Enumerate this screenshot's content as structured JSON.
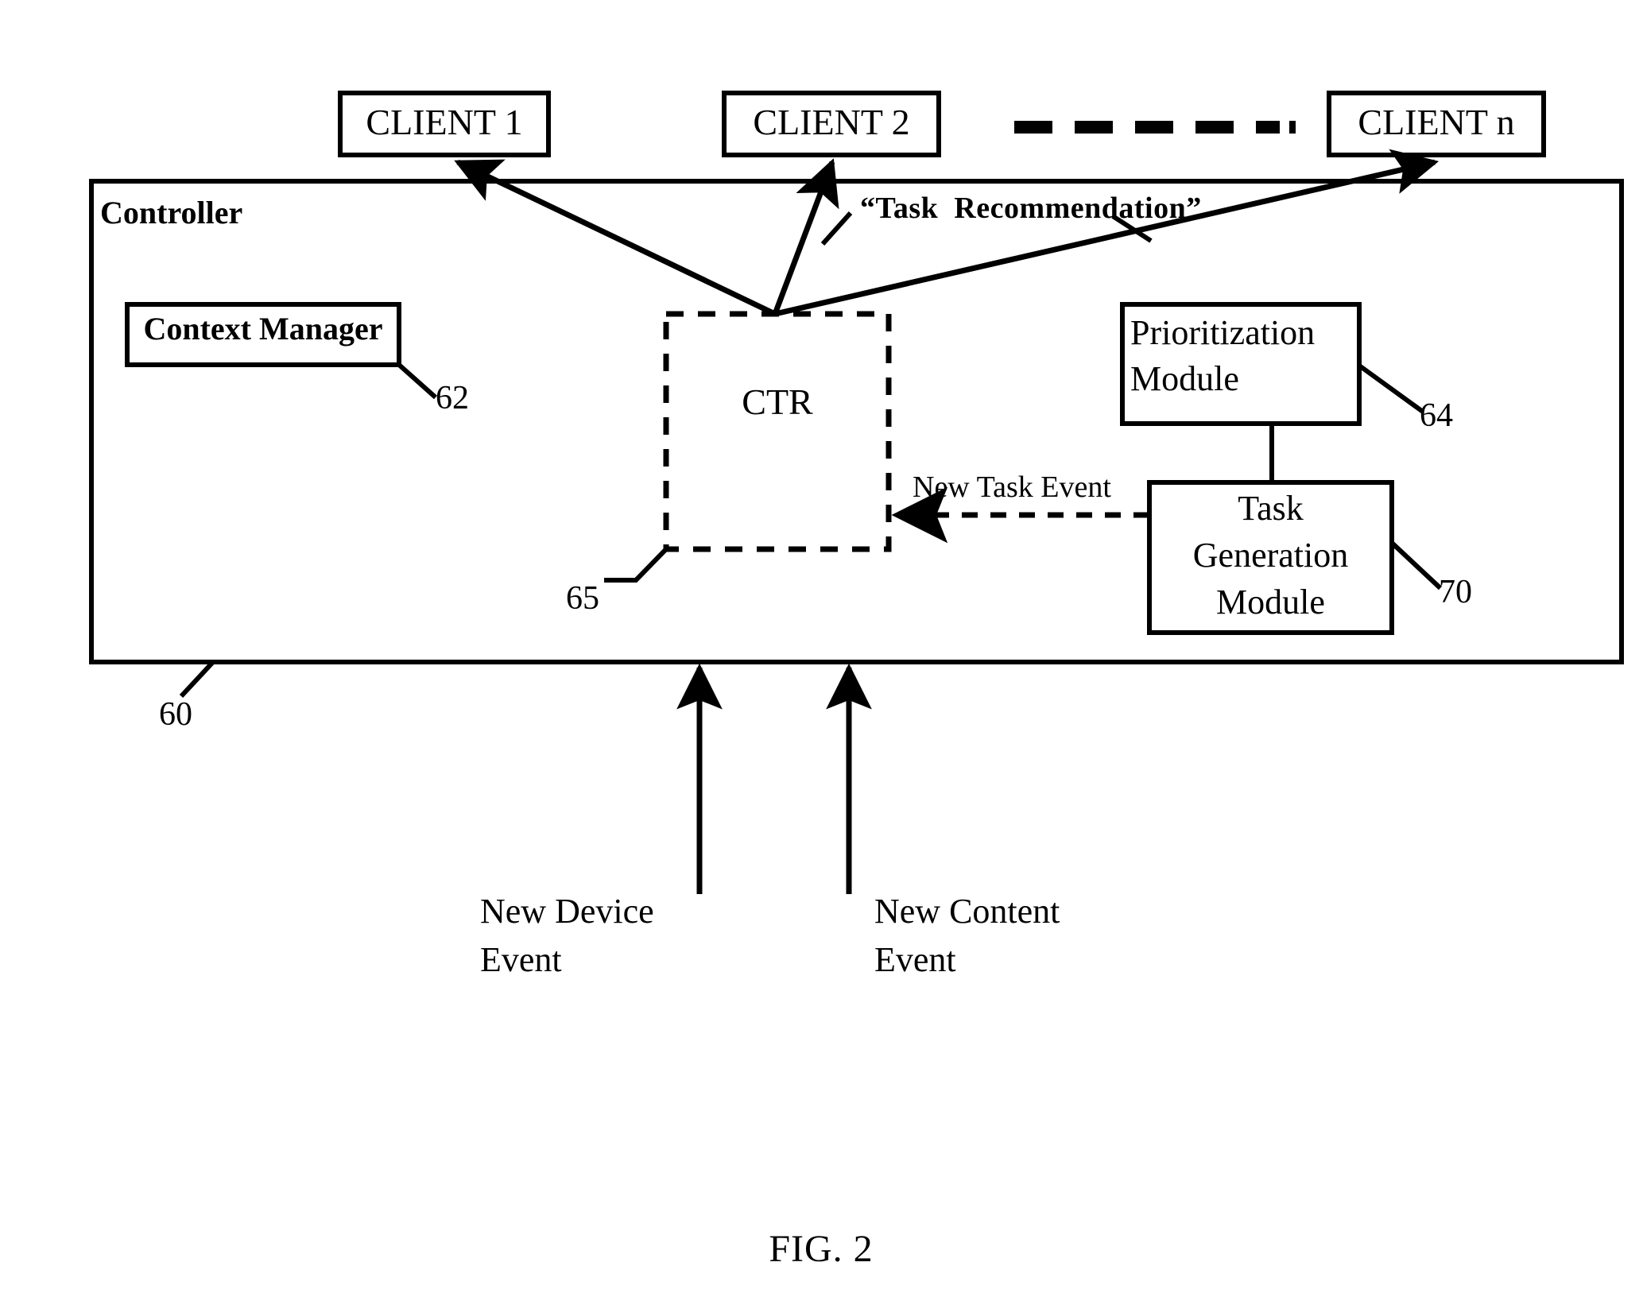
{
  "figure": {
    "caption": "FIG. 2",
    "title_blocks": {
      "controller": "Controller"
    }
  },
  "clients": [
    {
      "label": "CLIENT 1"
    },
    {
      "label": "CLIENT 2"
    },
    {
      "label": "CLIENT n"
    }
  ],
  "ellipsis": {
    "name": "dashed-ellipsis",
    "dash_count": 6
  },
  "controller": {
    "label": "Controller",
    "ref": "60",
    "blocks": [
      {
        "id": "context-manager",
        "label": "Context Manager",
        "ref": "62",
        "style": "solid"
      },
      {
        "id": "ctr",
        "label": "CTR",
        "ref": "65",
        "style": "dashed"
      },
      {
        "id": "prioritization-module",
        "label_line1": "Prioritization",
        "label_line2": "Module",
        "ref": "64",
        "style": "solid"
      },
      {
        "id": "task-generation-module",
        "label_line1": "Task",
        "label_line2": "Generation",
        "label_line3": "Module",
        "ref": "70",
        "style": "solid"
      }
    ]
  },
  "edges": {
    "task_recommendation": "“Task  Recommendation”",
    "new_task_event": "New Task Event"
  },
  "inputs": [
    {
      "id": "new-device-event",
      "line1": "New Device",
      "line2": "Event"
    },
    {
      "id": "new-content-event",
      "line1": "New Content",
      "line2": "Event"
    }
  ],
  "colors": {
    "ink": "#000000",
    "paper": "#ffffff"
  }
}
